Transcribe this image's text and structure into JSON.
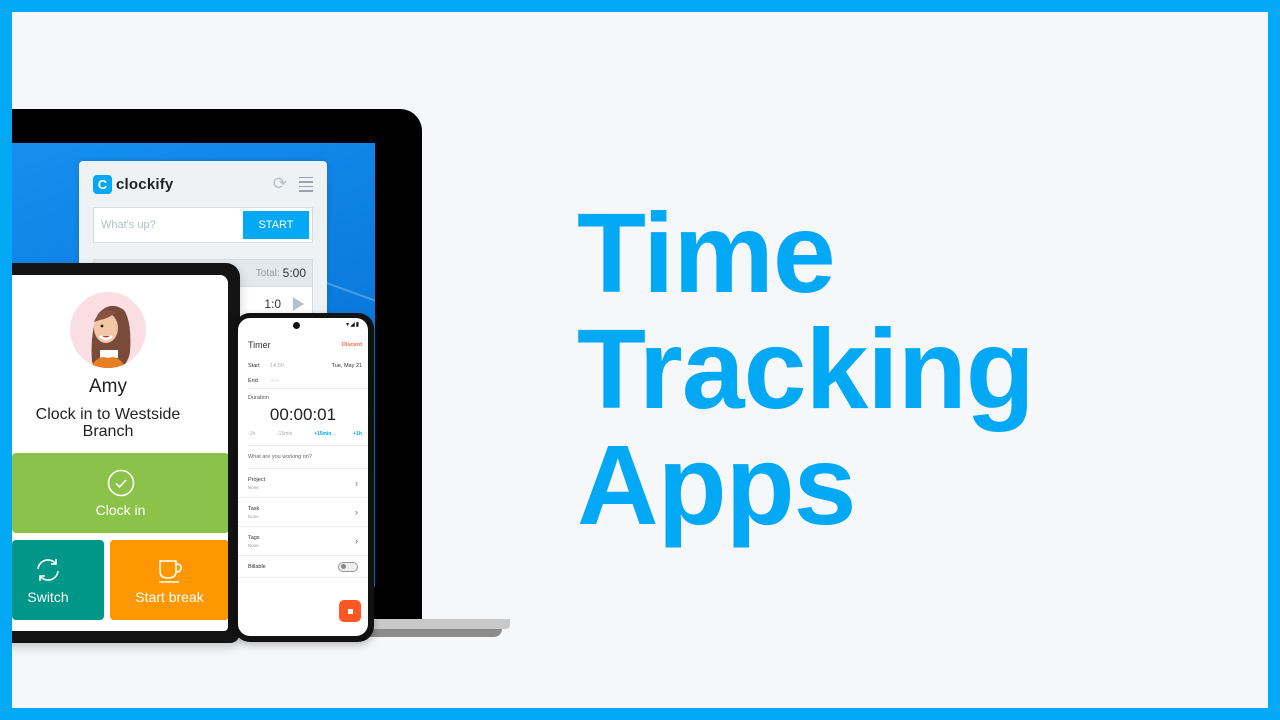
{
  "colors": {
    "brand_blue": "#03a9f4",
    "clock_in_green": "#8bc34a",
    "switch_teal": "#009688",
    "break_orange": "#ff9800",
    "stop_red": "#ff5722",
    "background": "#f6f7f8"
  },
  "headline": {
    "lines": [
      "Time",
      "Tracking",
      "Apps"
    ]
  },
  "desktop_app": {
    "brand": "clockify",
    "logo_glyph": "C",
    "icons": [
      "sync-icon",
      "menu-icon"
    ],
    "input_placeholder": "What's up?",
    "start_label": "START",
    "total_label": "Total:",
    "total_value": "5:00",
    "entry_duration": "1:0"
  },
  "kiosk_app": {
    "user_name": "Amy",
    "prompt": "Clock in to Westside Branch",
    "buttons": {
      "clock_in": "Clock in",
      "switch": "Switch",
      "start_break": "Start break"
    }
  },
  "mobile_app": {
    "title": "Timer",
    "discard_label": "Discard",
    "start_label": "Start",
    "start_time": "14:00",
    "start_date": "Tue, May 21",
    "end_label": "End",
    "end_time": "--:--",
    "duration_label": "Duration",
    "duration_value": "00:00:01",
    "adjust": [
      "-1h",
      "-15min",
      "+15min",
      "+1h"
    ],
    "working_on_placeholder": "What are you working on?",
    "fields": [
      {
        "label": "Project",
        "value": "None"
      },
      {
        "label": "Task",
        "value": "None"
      },
      {
        "label": "Tags",
        "value": "None"
      }
    ],
    "billable_label": "Billable",
    "billable_on": false
  }
}
